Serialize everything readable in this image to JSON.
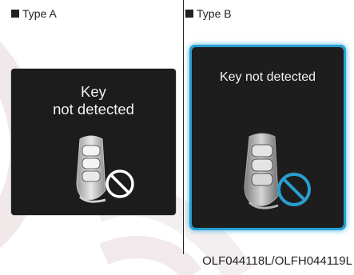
{
  "type_a": {
    "label": "Type A",
    "message_line1": "Key",
    "message_line2": "not detected",
    "icon": "smart-key-fob-icon",
    "prohibit_icon": "prohibition-icon",
    "prohibit_color": "#ffffff"
  },
  "type_b": {
    "label": "Type B",
    "message": "Key not detected",
    "icon": "smart-key-fob-icon",
    "prohibit_icon": "prohibition-icon",
    "prohibit_color": "#2a9ed0",
    "frame_color": "#2a9ed0"
  },
  "figure_code": "OLF044118L/OLFH044119L"
}
